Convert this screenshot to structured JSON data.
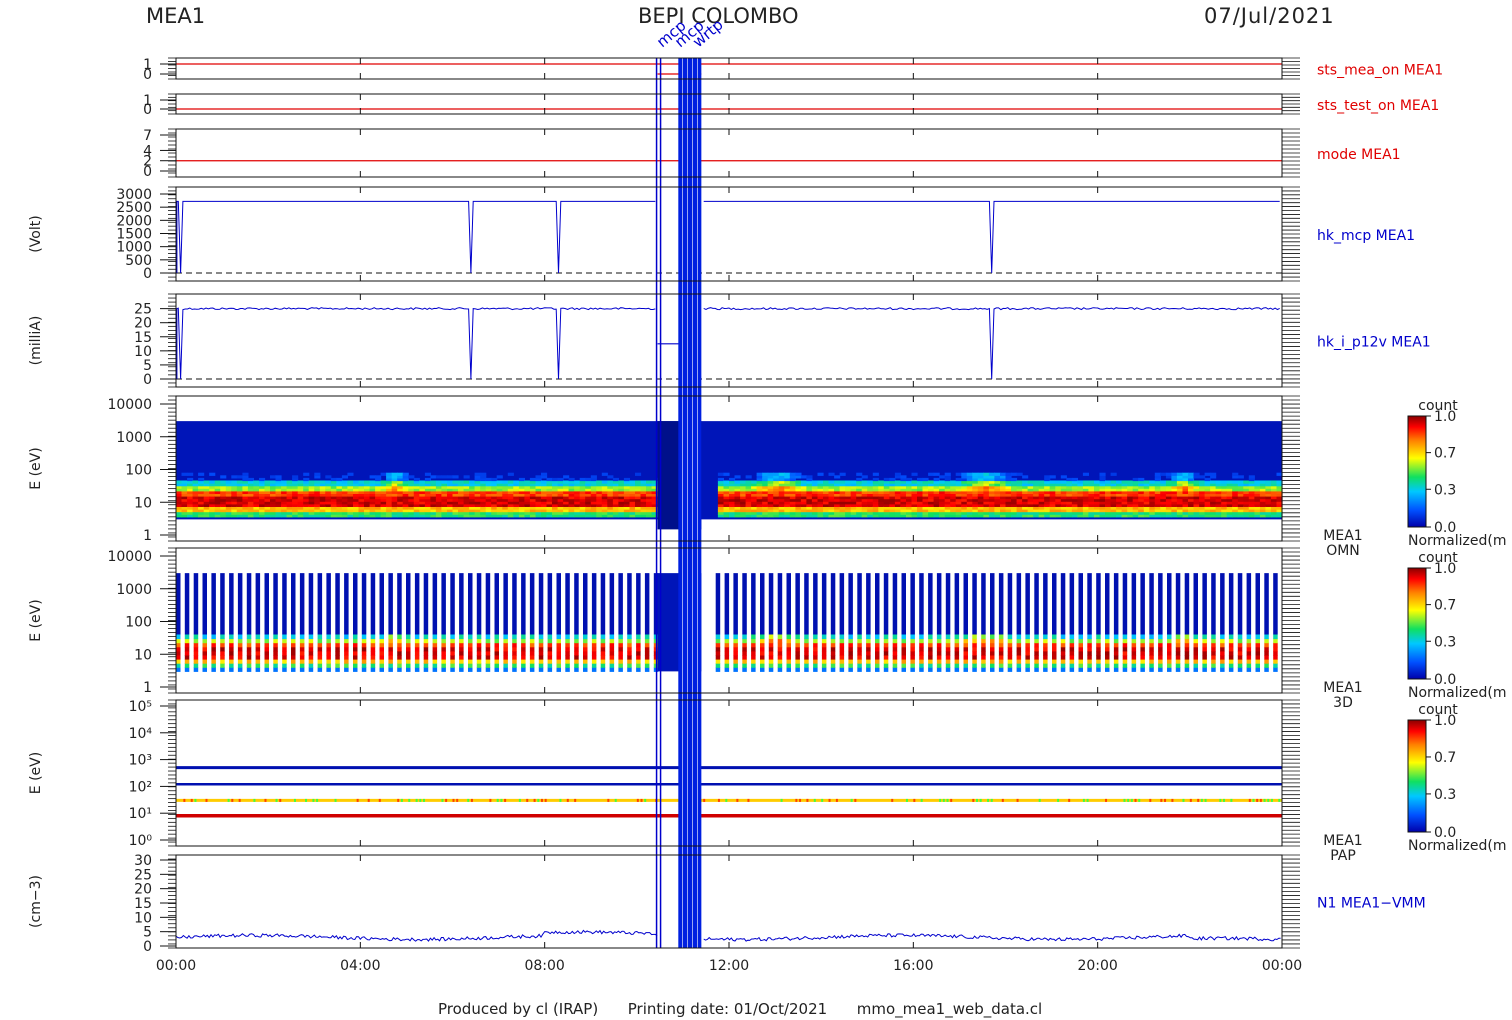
{
  "header": {
    "instrument": "MEA1",
    "mission": "BEPI COLOMBO",
    "date": "07/Jul/2021"
  },
  "footer": {
    "produced_by": "Produced by cl (IRAP)",
    "printing_date": "Printing date: 01/Oct/2021",
    "script": "mmo_mea1_web_data.cl"
  },
  "colors": {
    "red_trace": "#e00000",
    "blue_trace": "#0000cc",
    "background_fill": "#0015b8"
  },
  "chart_data": [
    {
      "type": "line",
      "panel_name": "sts_mea_on MEA1",
      "ylabel": "",
      "y_ticks": [
        "1",
        "0"
      ],
      "ylim": [
        0,
        1
      ],
      "value": 1,
      "color": "#e00000"
    },
    {
      "type": "line",
      "panel_name": "sts_test_on MEA1",
      "ylabel": "",
      "y_ticks": [
        "1",
        "0"
      ],
      "ylim": [
        0,
        1
      ],
      "value": 0,
      "color": "#e00000"
    },
    {
      "type": "line",
      "panel_name": "mode MEA1",
      "ylabel": "",
      "y_ticks": [
        "7",
        "4",
        "2",
        "0"
      ],
      "ylim": [
        0,
        7
      ],
      "value": 2,
      "color": "#e00000"
    },
    {
      "type": "line",
      "panel_name": "hk_mcp MEA1",
      "ylabel": "(Volt)",
      "y_ticks": [
        "3000",
        "2500",
        "2000",
        "1500",
        "1000",
        "500",
        "0"
      ],
      "ylim": [
        0,
        3000
      ],
      "baseline": 2720,
      "dropouts_hours": [
        0.1,
        6.4,
        8.3,
        17.7
      ]
    },
    {
      "type": "line",
      "panel_name": "hk_i_p12v MEA1",
      "ylabel": "(milliA)",
      "y_ticks": [
        "25",
        "20",
        "15",
        "10",
        "5",
        "0"
      ],
      "ylim": [
        0,
        27
      ],
      "baseline": 25,
      "dropouts_hours": [
        0.1,
        6.4,
        8.3,
        17.7
      ]
    },
    {
      "type": "heatmap",
      "panel_name": "MEA1 OMN",
      "ylabel": "E (eV)",
      "y_ticks": [
        "10000",
        "1000",
        "100",
        "10",
        "1"
      ],
      "ylim": [
        1,
        10000
      ],
      "log": true,
      "colorbar": {
        "title": "count",
        "ticks": [
          "1.0",
          "0.7",
          "0.3",
          "0.0"
        ],
        "label": "Normalized(m"
      }
    },
    {
      "type": "heatmap",
      "panel_name": "MEA1 3D",
      "ylabel": "E (eV)",
      "y_ticks": [
        "10000",
        "1000",
        "100",
        "10",
        "1"
      ],
      "ylim": [
        1,
        10000
      ],
      "log": true,
      "colorbar": {
        "title": "count",
        "ticks": [
          "1.0",
          "0.7",
          "0.3",
          "0.0"
        ],
        "label": "Normalized(m"
      }
    },
    {
      "type": "heatmap",
      "panel_name": "MEA1 PAP",
      "ylabel": "E (eV)",
      "y_ticks": [
        "10⁵",
        "10⁴",
        "10³",
        "10²",
        "10¹",
        "10⁰"
      ],
      "ylim": [
        1,
        100000
      ],
      "log": true,
      "colorbar": {
        "title": "count",
        "ticks": [
          "1.0",
          "0.7",
          "0.3",
          "0.0"
        ],
        "label": "Normalized(m"
      }
    },
    {
      "type": "line",
      "panel_name": "N1 MEA1−VMM",
      "ylabel": "(cm−3)",
      "y_ticks": [
        "30",
        "25",
        "20",
        "15",
        "10",
        "5",
        "0"
      ],
      "ylim": [
        0,
        30
      ],
      "baseline": 3
    }
  ],
  "x_axis": {
    "ticks": [
      "00:00",
      "04:00",
      "08:00",
      "12:00",
      "16:00",
      "20:00",
      "00:00"
    ],
    "range_hours": [
      0,
      24
    ],
    "gap_hours": [
      10.45,
      11.4
    ]
  },
  "annotations": [
    "mcp",
    "mcp",
    "wrtp"
  ]
}
